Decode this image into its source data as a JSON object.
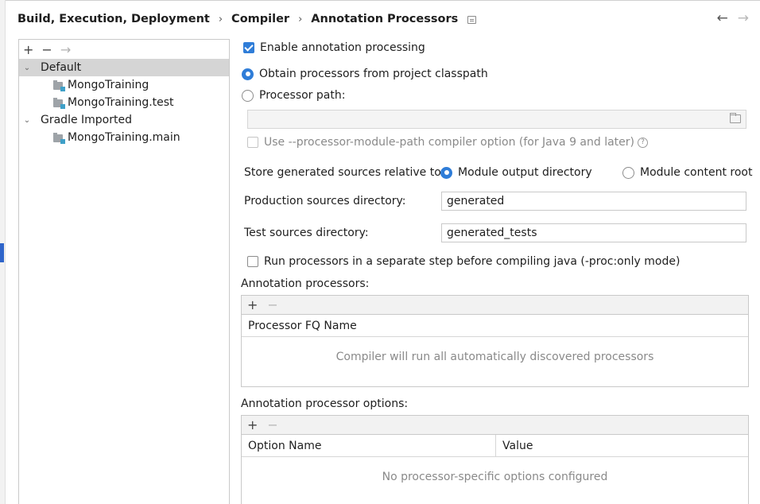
{
  "breadcrumb": {
    "items": [
      "Build, Execution, Deployment",
      "Compiler",
      "Annotation Processors"
    ],
    "separator": "›"
  },
  "nav": {
    "back": "←",
    "forward": "→"
  },
  "tree": {
    "toolbar": {
      "add": "+",
      "remove": "−",
      "move": "→"
    },
    "items": [
      {
        "label": "Default",
        "level": 0,
        "expanded": true,
        "selected": true
      },
      {
        "label": "MongoTraining",
        "level": 1
      },
      {
        "label": "MongoTraining.test",
        "level": 1
      },
      {
        "label": "Gradle Imported",
        "level": 0,
        "expanded": true
      },
      {
        "label": "MongoTraining.main",
        "level": 1
      }
    ]
  },
  "form": {
    "enable_processing": {
      "label": "Enable annotation processing",
      "checked": true
    },
    "obtain_from_classpath": {
      "label": "Obtain processors from project classpath",
      "selected": true
    },
    "processor_path": {
      "label": "Processor path:",
      "selected": false,
      "value": ""
    },
    "processor_module_path": {
      "label": "Use --processor-module-path compiler option (for Java 9 and later)",
      "checked": false,
      "enabled": false,
      "help": "?"
    },
    "store_generated": {
      "label": "Store generated sources relative to:",
      "options": [
        "Module output directory",
        "Module content root"
      ],
      "selected": "Module output directory"
    },
    "production_dir": {
      "label": "Production sources directory:",
      "value": "generated"
    },
    "test_dir": {
      "label": "Test sources directory:",
      "value": "generated_tests"
    },
    "separate_step": {
      "label": "Run processors in a separate step before compiling java (-proc:only mode)",
      "checked": false
    }
  },
  "annotation_processors": {
    "label": "Annotation processors:",
    "toolbar": {
      "add": "+",
      "remove": "−"
    },
    "column": "Processor FQ Name",
    "empty_text": "Compiler will run all automatically discovered processors"
  },
  "processor_options": {
    "label": "Annotation processor options:",
    "toolbar": {
      "add": "+",
      "remove": "−"
    },
    "columns": [
      "Option Name",
      "Value"
    ],
    "empty_text": "No processor-specific options configured"
  },
  "colors": {
    "accent": "#2f7dd8",
    "selection": "#d5d5d5",
    "side_selection": "#2f65ca"
  }
}
